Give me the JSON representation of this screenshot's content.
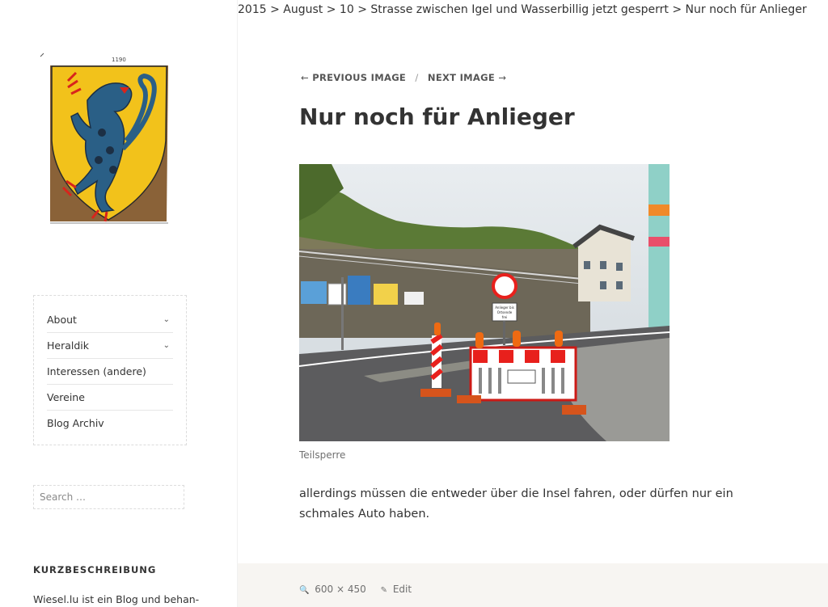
{
  "breadcrumb": [
    {
      "label": "2015"
    },
    {
      "label": "August"
    },
    {
      "label": "10"
    },
    {
      "label": "Strasse zwischen Igel und Wasserbillig jetzt gesperrt"
    },
    {
      "label": "Nur noch für Anlieger"
    }
  ],
  "breadcrumb_separator": ">",
  "logo": {
    "number": "1190"
  },
  "sidebar": {
    "menu": [
      {
        "label": "About",
        "has_submenu": true
      },
      {
        "label": "Heraldik",
        "has_submenu": true
      },
      {
        "label": "Interessen (andere)",
        "has_submenu": false
      },
      {
        "label": "Vereine",
        "has_submenu": false
      },
      {
        "label": "Blog Archiv",
        "has_submenu": false
      }
    ],
    "search": {
      "placeholder": "Search …"
    },
    "widget": {
      "title": "KURZBESCHREIBUNG",
      "text": "Wiesel.lu ist ein Blog und behan-"
    }
  },
  "image_nav": {
    "previous": "PREVIOUS IMAGE",
    "next": "NEXT IMAGE",
    "separator": "/"
  },
  "entry": {
    "title": "Nur noch für Anlieger",
    "caption": "Teilsperre",
    "text": "allerdings müssen die entweder über die Insel fahren, oder dürfen nur ein schmales Auto haben."
  },
  "photo_sign": {
    "line1": "Anlieger bis",
    "line2": "Ortsende",
    "line3": "frei"
  },
  "footer": {
    "dimensions": "600 × 450",
    "edit": "Edit"
  },
  "colors": {
    "shield_yellow": "#f2c21b",
    "lion_blue": "#2a5f86",
    "barrier_red": "#e8201c",
    "footer_bg": "#f7f5f2"
  },
  "icons": {
    "arrow_left": "←",
    "arrow_right": "→",
    "chevron": "⌄",
    "zoom": "🔍",
    "pencil": "✎"
  }
}
